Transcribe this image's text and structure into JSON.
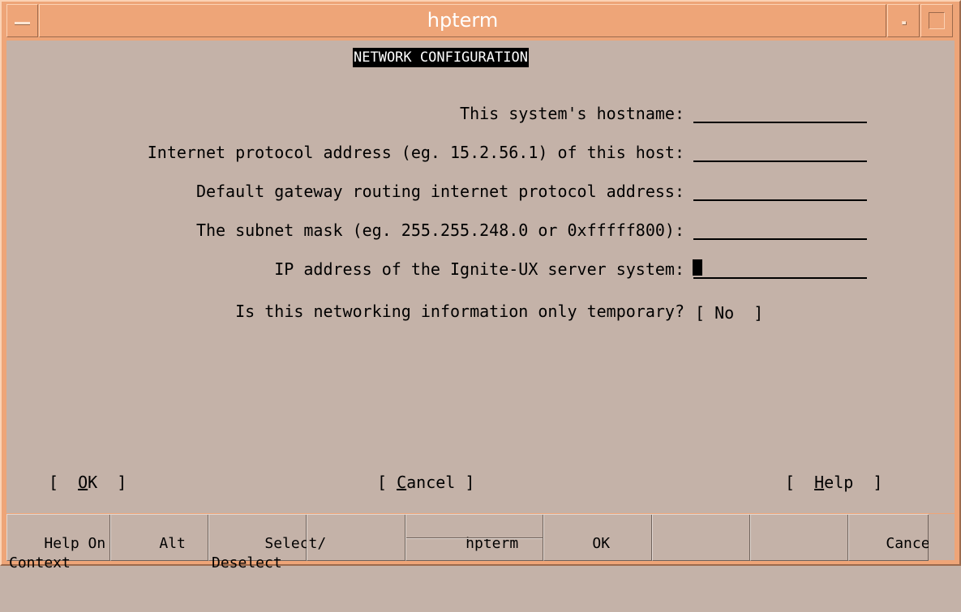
{
  "window": {
    "title": "hpterm"
  },
  "screen": {
    "heading": "NETWORK CONFIGURATION",
    "fields": [
      {
        "label": "This system's hostname:",
        "value": ""
      },
      {
        "label": "Internet protocol address (eg. 15.2.56.1) of this host:",
        "value": ""
      },
      {
        "label": "Default gateway routing internet protocol address:",
        "value": ""
      },
      {
        "label": "The subnet mask (eg. 255.255.248.0 or 0xfffff800):",
        "value": ""
      },
      {
        "label": "IP address of the Ignite-UX server system:",
        "value": ""
      }
    ],
    "temporary_question": "Is this networking information only temporary?",
    "temporary_value": "[ No  ]",
    "buttons": {
      "ok": {
        "open": "[  ",
        "hotkey": "O",
        "rest": "K",
        "close": "  ]"
      },
      "cancel": {
        "open": "[ ",
        "hotkey": "C",
        "rest": "ancel",
        "close": " ]"
      },
      "help": {
        "open": "[  ",
        "hotkey": "H",
        "rest": "elp",
        "close": "  ]"
      }
    }
  },
  "function_keys": [
    {
      "line1": "Help On",
      "line2": "Context"
    },
    {
      "line1": "Alt",
      "line2": ""
    },
    {
      "line1": "Select/",
      "line2": "Deselect"
    },
    {
      "line1": "",
      "line2": ""
    },
    {
      "line1": "hpterm",
      "line2": ""
    },
    {
      "line1": "OK",
      "line2": ""
    },
    {
      "line1": "",
      "line2": ""
    },
    {
      "line1": "",
      "line2": ""
    },
    {
      "line1": "Cancel",
      "line2": ""
    }
  ],
  "colors": {
    "frame": "#eea578",
    "background": "#c4b2a8",
    "text": "#000000",
    "title_text": "#ffffff"
  }
}
